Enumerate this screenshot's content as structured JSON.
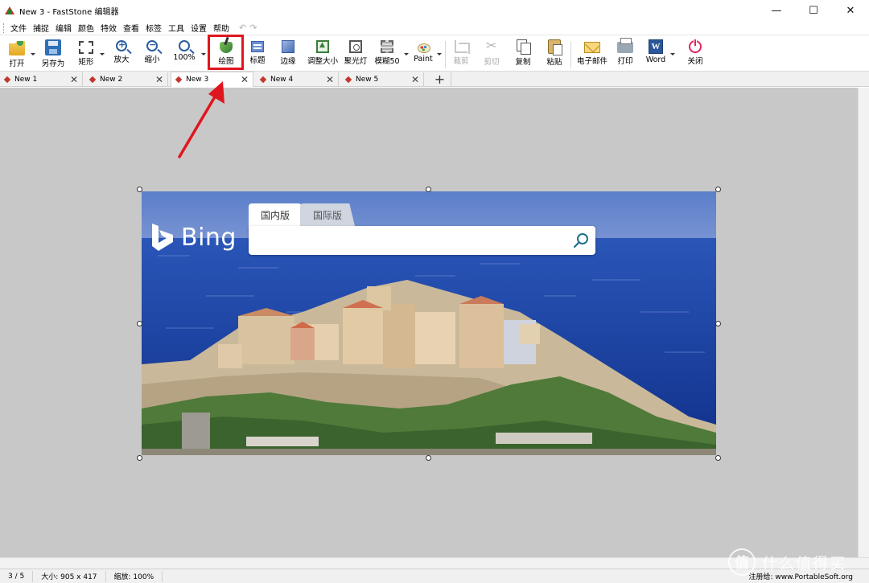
{
  "window": {
    "title": "New 3 - FastStone 编辑器",
    "controls": [
      "—",
      "☐",
      "✕"
    ]
  },
  "menu": {
    "items": [
      "文件",
      "捕捉",
      "编辑",
      "颜色",
      "特效",
      "查看",
      "标签",
      "工具",
      "设置",
      "帮助"
    ],
    "undo": "↶",
    "redo": "↷"
  },
  "toolbar": {
    "open": "打开",
    "save_as": "另存为",
    "rect": "矩形",
    "zoom_in": "放大",
    "zoom_out": "缩小",
    "zoom_100": "100%",
    "draw": "绘图",
    "caption": "标题",
    "edge": "边缘",
    "resize": "调整大小",
    "spotlight": "聚光灯",
    "blur": "模糊50",
    "paint": "Paint",
    "crop": "裁剪",
    "cut": "剪切",
    "copy": "复制",
    "paste": "粘贴",
    "email": "电子邮件",
    "print": "打印",
    "word": "Word",
    "word_icon": "W",
    "close": "关闭"
  },
  "tabs": [
    {
      "label": "New 1",
      "active": false
    },
    {
      "label": "New 2",
      "active": false
    },
    {
      "label": "New 3",
      "active": true
    },
    {
      "label": "New 4",
      "active": false
    },
    {
      "label": "New 5",
      "active": false
    }
  ],
  "tab_add": "+",
  "tab_close": "✕",
  "image": {
    "logo_text": "Bing",
    "search_tabs": [
      "国内版",
      "国际版"
    ],
    "search_value": ""
  },
  "status": {
    "page": "3 / 5",
    "size": "大小: 905 x 417",
    "zoom": "缩放: 100%",
    "register": "注册给: www.PortableSoft.org"
  },
  "watermark": {
    "mark": "值",
    "text": "什么值得买"
  },
  "colors": {
    "highlight": "#e0161e",
    "canvas": "#c8c8c8",
    "sea": "#1a3f9a",
    "sky": "#5b7fc9"
  },
  "icons": {
    "search": "magnifier-icon",
    "bing": "bing-logo-icon"
  }
}
